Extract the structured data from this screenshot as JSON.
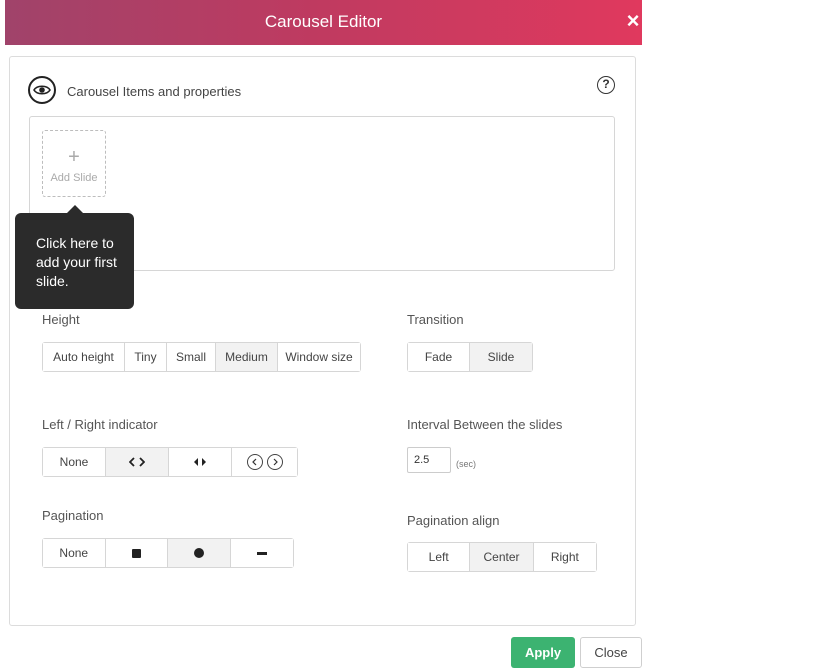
{
  "header": {
    "title": "Carousel Editor",
    "close_icon": "×"
  },
  "section": {
    "title": "Carousel Items and properties",
    "help": "?"
  },
  "add_slide": {
    "plus": "+",
    "label": "Add Slide"
  },
  "tooltip": {
    "text": "Click here to add your first slide."
  },
  "height": {
    "label": "Height",
    "options": [
      "Auto height",
      "Tiny",
      "Small",
      "Medium",
      "Window size"
    ],
    "selected": "Medium"
  },
  "transition": {
    "label": "Transition",
    "options": [
      "Fade",
      "Slide"
    ],
    "selected": "Slide"
  },
  "indicator": {
    "label": "Left / Right indicator",
    "none_label": "None",
    "selected": "chevrons",
    "icons": [
      "chevrons-icon",
      "triangles-icon",
      "circled-arrows-icon"
    ]
  },
  "interval": {
    "label": "Interval Between the slides",
    "value": "2.5",
    "unit": "(sec)"
  },
  "pagination": {
    "label": "Pagination",
    "none_label": "None",
    "selected": "dot",
    "icons": [
      "square-icon",
      "dot-icon",
      "dash-icon"
    ]
  },
  "pagination_align": {
    "label": "Pagination align",
    "options": [
      "Left",
      "Center",
      "Right"
    ],
    "selected": "Center"
  },
  "footer": {
    "apply": "Apply",
    "close": "Close"
  },
  "colors": {
    "accent_start": "#a0436a",
    "accent_end": "#e0395e",
    "apply": "#3cb371"
  }
}
